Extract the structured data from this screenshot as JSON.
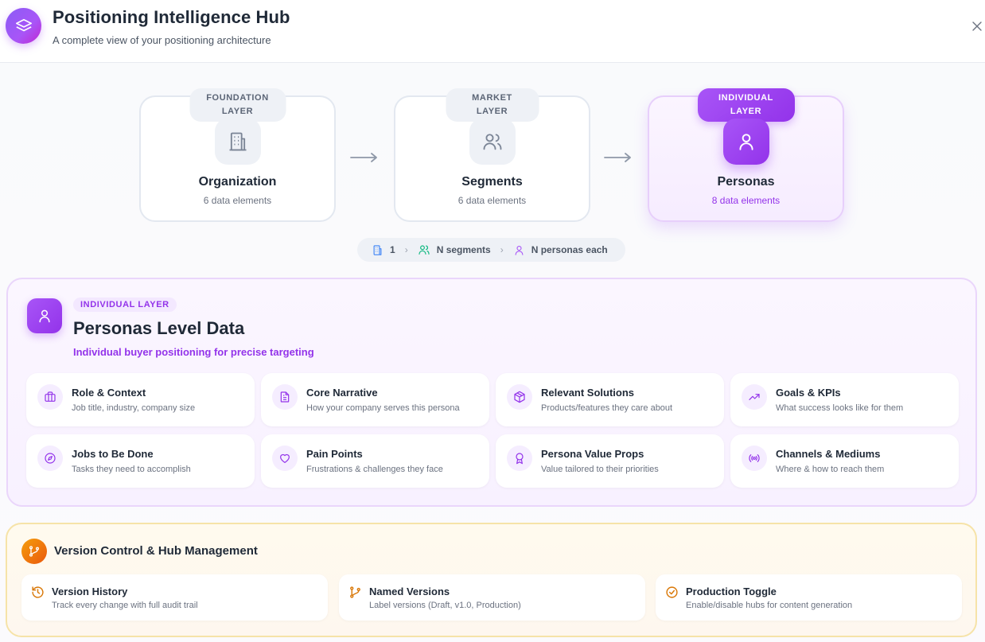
{
  "header": {
    "title": "Positioning Intelligence Hub",
    "subtitle": "A complete view of your positioning architecture",
    "icon": "layers-icon"
  },
  "layers": [
    {
      "pill": "FOUNDATION LAYER",
      "name": "Organization",
      "count": "6 data elements",
      "icon": "building-icon",
      "active": false
    },
    {
      "pill": "MARKET LAYER",
      "name": "Segments",
      "count": "6 data elements",
      "icon": "users-icon",
      "active": false
    },
    {
      "pill": "INDIVIDUAL LAYER",
      "name": "Personas",
      "count": "8 data elements",
      "icon": "user-icon",
      "active": true
    }
  ],
  "hierarchy": {
    "org": "1",
    "segments": "N segments",
    "personas": "N personas each"
  },
  "persona_panel": {
    "tag": "INDIVIDUAL LAYER",
    "title": "Personas Level Data",
    "subtitle": "Individual buyer positioning for precise targeting",
    "items": [
      {
        "title": "Role & Context",
        "desc": "Job title, industry, company size",
        "icon": "briefcase-icon"
      },
      {
        "title": "Core Narrative",
        "desc": "How your company serves this persona",
        "icon": "document-icon"
      },
      {
        "title": "Relevant Solutions",
        "desc": "Products/features they care about",
        "icon": "box-icon"
      },
      {
        "title": "Goals & KPIs",
        "desc": "What success looks like for them",
        "icon": "trending-up-icon"
      },
      {
        "title": "Jobs to Be Done",
        "desc": "Tasks they need to accomplish",
        "icon": "compass-icon"
      },
      {
        "title": "Pain Points",
        "desc": "Frustrations & challenges they face",
        "icon": "heart-icon"
      },
      {
        "title": "Persona Value Props",
        "desc": "Value tailored to their priorities",
        "icon": "award-icon"
      },
      {
        "title": "Channels & Mediums",
        "desc": "Where & how to reach them",
        "icon": "broadcast-icon"
      }
    ]
  },
  "version_control": {
    "title": "Version Control & Hub Management",
    "items": [
      {
        "title": "Version History",
        "desc": "Track every change with full audit trail",
        "icon": "history-icon"
      },
      {
        "title": "Named Versions",
        "desc": "Label versions (Draft, v1.0, Production)",
        "icon": "git-branch-icon"
      },
      {
        "title": "Production Toggle",
        "desc": "Enable/disable hubs for content generation",
        "icon": "check-circle-icon"
      }
    ]
  },
  "colors": {
    "accent": "#9333ea",
    "accent_light": "#f3e8ff",
    "warning": "#ea580c"
  }
}
